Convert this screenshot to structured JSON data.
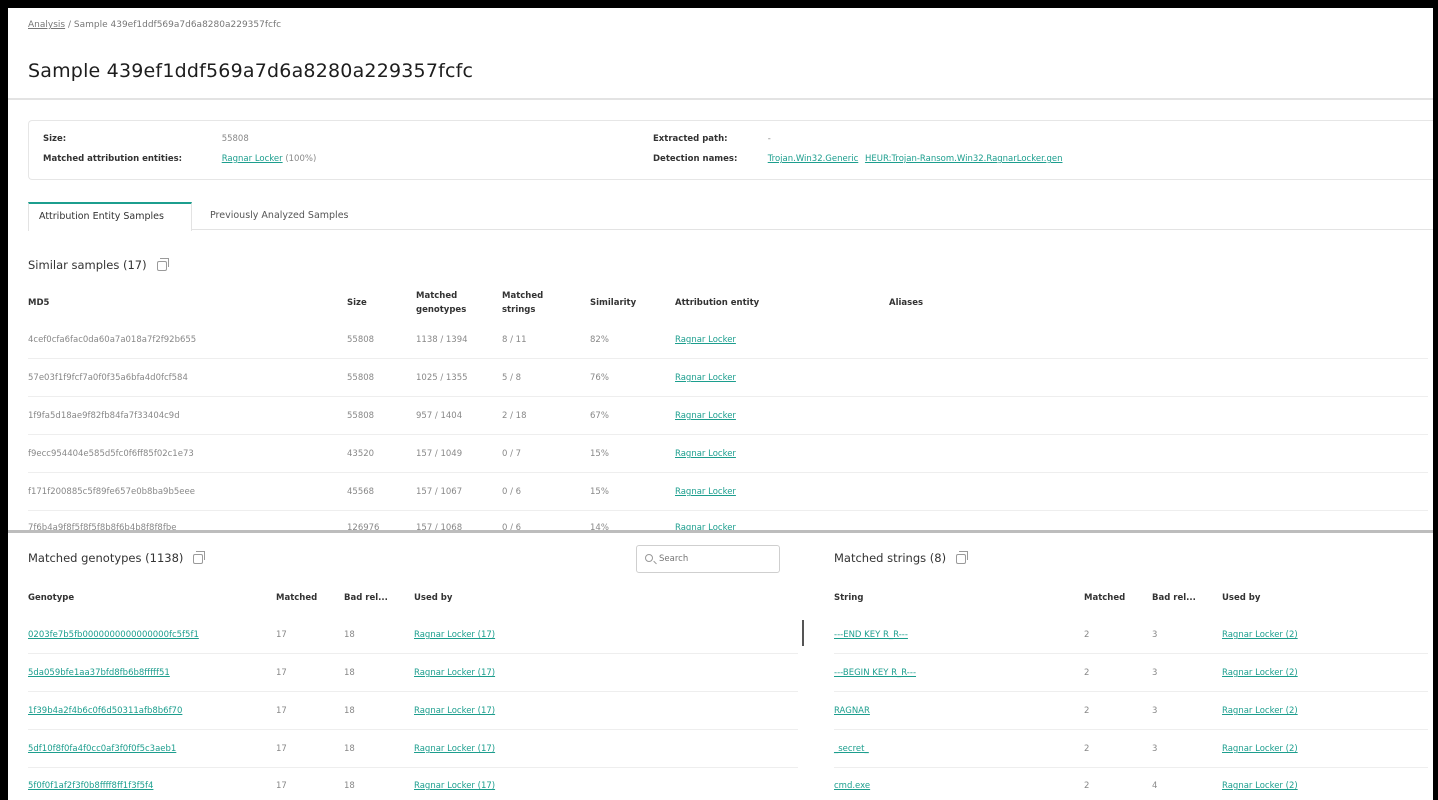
{
  "breadcrumb": {
    "parent": "Analysis",
    "separator": "/",
    "current": "Sample 439ef1ddf569a7d6a8280a229357fcfc"
  },
  "page_title": "Sample 439ef1ddf569a7d6a8280a229357fcfc",
  "info": {
    "size_label": "Size:",
    "size_value": "55808",
    "matched_label": "Matched attribution entities:",
    "matched_entity": "Ragnar Locker",
    "matched_pct": "(100%)",
    "path_label": "Extracted path:",
    "path_value": "-",
    "detection_label": "Detection names:",
    "detection_1": "Trojan.Win32.Generic",
    "detection_2": "HEUR:Trojan-Ransom.Win32.RagnarLocker.gen"
  },
  "tabs": [
    {
      "label": "Attribution Entity Samples",
      "active": true
    },
    {
      "label": "Previously Analyzed Samples",
      "active": false
    }
  ],
  "similar": {
    "title": "Similar samples (17)",
    "headers": {
      "md5": "MD5",
      "size": "Size",
      "genotypes_1": "Matched",
      "genotypes_2": "genotypes",
      "strings_1": "Matched",
      "strings_2": "strings",
      "similarity": "Similarity",
      "entity": "Attribution entity",
      "aliases": "Aliases"
    },
    "rows": [
      {
        "md5": "4cef0cfa6fac0da60a7a018a7f2f92b655",
        "size": "55808",
        "genotypes": "1138 / 1394",
        "strings": "8 / 11",
        "similarity": "82%",
        "entity": "Ragnar Locker"
      },
      {
        "md5": "57e03f1f9fcf7a0f0f35a6bfa4d0fcf584",
        "size": "55808",
        "genotypes": "1025 / 1355",
        "strings": "5 / 8",
        "similarity": "76%",
        "entity": "Ragnar Locker"
      },
      {
        "md5": "1f9fa5d18ae9f82fb84fa7f33404c9d",
        "size": "55808",
        "genotypes": "957 / 1404",
        "strings": "2 / 18",
        "similarity": "67%",
        "entity": "Ragnar Locker"
      },
      {
        "md5": "f9ecc954404e585d5fc0f6ff85f02c1e73",
        "size": "43520",
        "genotypes": "157 / 1049",
        "strings": "0 / 7",
        "similarity": "15%",
        "entity": "Ragnar Locker"
      },
      {
        "md5": "f171f200885c5f89fe657e0b8ba9b5eee",
        "size": "45568",
        "genotypes": "157 / 1067",
        "strings": "0 / 6",
        "similarity": "15%",
        "entity": "Ragnar Locker"
      },
      {
        "md5": "7f6b4a9f8f5f8f5f8b8f6b4b8f8f8fbe",
        "size": "126976",
        "genotypes": "157 / 1068",
        "strings": "0 / 6",
        "similarity": "14%",
        "entity": "Ragnar Locker"
      }
    ]
  },
  "genotypes": {
    "title": "Matched genotypes (1138)",
    "search_placeholder": "Search",
    "headers": {
      "genotype": "Genotype",
      "matched": "Matched",
      "bad": "Bad rel...",
      "used_by": "Used by"
    },
    "rows": [
      {
        "genotype": "0203fe7b5fb0000000000000000fc5f5f1",
        "matched": "17",
        "bad": "18",
        "used_by": "Ragnar Locker (17)"
      },
      {
        "genotype": "5da059bfe1aa37bfd8fb6b8fffff51",
        "matched": "17",
        "bad": "18",
        "used_by": "Ragnar Locker (17)"
      },
      {
        "genotype": "1f39b4a2f4b6c0f6d50311afb8b6f70",
        "matched": "17",
        "bad": "18",
        "used_by": "Ragnar Locker (17)"
      },
      {
        "genotype": "5df10f8f0fa4f0cc0af3f0f0f5c3aeb1",
        "matched": "17",
        "bad": "18",
        "used_by": "Ragnar Locker (17)"
      },
      {
        "genotype": "5f0f0f1af2f3f0b8ffff8ff1f3f5f4",
        "matched": "17",
        "bad": "18",
        "used_by": "Ragnar Locker (17)"
      }
    ]
  },
  "strings": {
    "title": "Matched strings (8)",
    "headers": {
      "string": "String",
      "matched": "Matched",
      "bad": "Bad rel...",
      "used_by": "Used by"
    },
    "rows": [
      {
        "string": "---END KEY R_R---",
        "matched": "2",
        "bad": "3",
        "used_by": "Ragnar Locker (2)"
      },
      {
        "string": "---BEGIN KEY R_R---",
        "matched": "2",
        "bad": "3",
        "used_by": "Ragnar Locker (2)"
      },
      {
        "string": "RAGNAR",
        "matched": "2",
        "bad": "3",
        "used_by": "Ragnar Locker (2)"
      },
      {
        "string": "_secret_",
        "matched": "2",
        "bad": "3",
        "used_by": "Ragnar Locker (2)"
      },
      {
        "string": "cmd.exe",
        "matched": "2",
        "bad": "4",
        "used_by": "Ragnar Locker (2)"
      }
    ]
  }
}
